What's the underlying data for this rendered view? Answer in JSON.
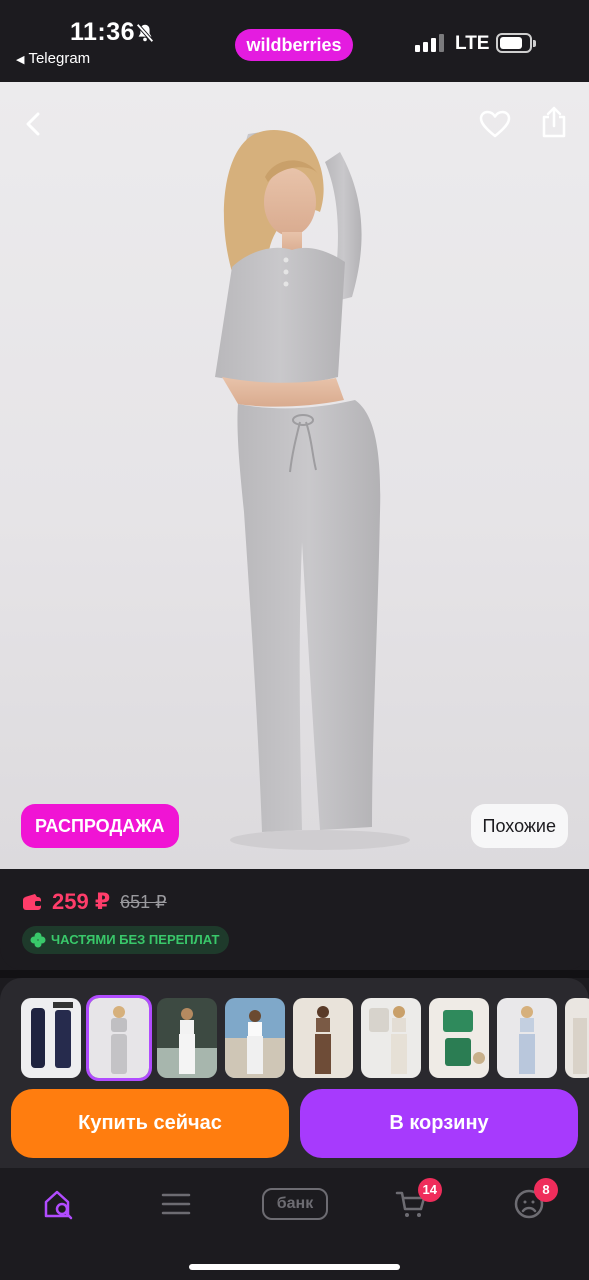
{
  "status_bar": {
    "time": "11:36",
    "back_app": "Telegram",
    "brand": "wildberries",
    "network": "LTE"
  },
  "hero": {
    "sale_label": "РАСПРОДАЖА",
    "similar_label": "Похожие"
  },
  "price": {
    "current": "259 ₽",
    "old": "651 ₽",
    "installment": "ЧАСТЯМИ БЕЗ ПЕРЕПЛАТ"
  },
  "actions": {
    "buy_now": "Купить сейчас",
    "add_to_cart": "В корзину"
  },
  "nav": {
    "bank": "банк",
    "cart_badge": "14",
    "profile_badge": "8"
  },
  "colors": {
    "brand": "#e41ce0",
    "price": "#ff3d6a",
    "buy_now": "#ff7d0f",
    "cart": "#a73afd",
    "installment": "#39c86a"
  }
}
